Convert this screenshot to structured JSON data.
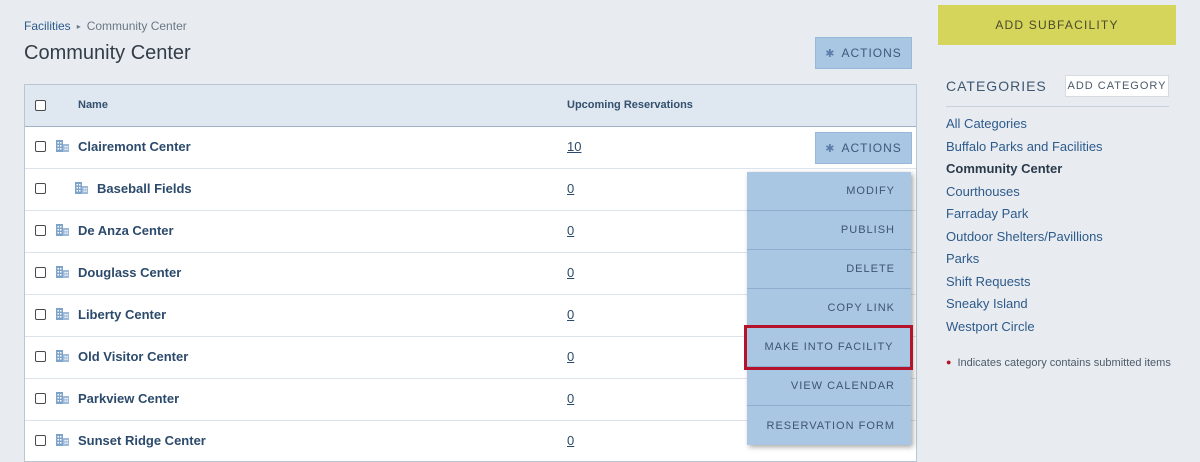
{
  "breadcrumb": {
    "root": "Facilities",
    "separator": "▸",
    "current": "Community Center"
  },
  "page_title": "Community Center",
  "actions_label": "ACTIONS",
  "table": {
    "headers": {
      "name": "Name",
      "reservations": "Upcoming Reservations"
    },
    "rows": [
      {
        "name": "Clairemont Center",
        "count": "10",
        "indent": false
      },
      {
        "name": "Baseball Fields",
        "count": "0",
        "indent": true
      },
      {
        "name": "De Anza Center",
        "count": "0",
        "indent": false
      },
      {
        "name": "Douglass Center",
        "count": "0",
        "indent": false
      },
      {
        "name": "Liberty Center",
        "count": "0",
        "indent": false
      },
      {
        "name": "Old Visitor Center",
        "count": "0",
        "indent": false
      },
      {
        "name": "Parkview Center",
        "count": "0",
        "indent": false
      },
      {
        "name": "Sunset Ridge Center",
        "count": "0",
        "indent": false
      }
    ]
  },
  "dropdown": {
    "items": [
      "MODIFY",
      "PUBLISH",
      "DELETE",
      "COPY LINK",
      "MAKE INTO FACILITY",
      "VIEW CALENDAR",
      "RESERVATION FORM"
    ],
    "highlighted_index": 4
  },
  "sidebar": {
    "add_subfacility": "ADD SUBFACILITY",
    "categories_title": "CATEGORIES",
    "add_category": "ADD CATEGORY",
    "categories": [
      "All Categories",
      "Buffalo Parks and Facilities",
      "Community Center",
      "Courthouses",
      "Farraday Park",
      "Outdoor Shelters/Pavillions",
      "Parks",
      "Shift Requests",
      "Sneaky Island",
      "Westport Circle"
    ],
    "active_category_index": 2,
    "legend": "Indicates category contains submitted items"
  },
  "colors": {
    "accent": "#a9c6e3",
    "add_subfacility": "#d5d45b",
    "highlight": "#b5122b",
    "link": "#2d5a8a"
  }
}
